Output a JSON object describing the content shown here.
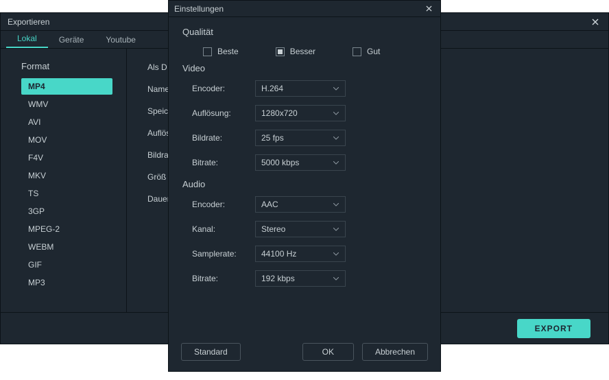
{
  "export": {
    "title": "Exportieren",
    "tabs": [
      "Lokal",
      "Geräte",
      "Youtube"
    ],
    "active_tab": 0,
    "sidebar_heading": "Format",
    "formats": [
      "MP4",
      "WMV",
      "AVI",
      "MOV",
      "F4V",
      "MKV",
      "TS",
      "3GP",
      "MPEG-2",
      "WEBM",
      "GIF",
      "MP3"
    ],
    "selected_format": 0,
    "main_labels": [
      "Als D",
      "Name",
      "Speich",
      "Auflös",
      "Bildra",
      "Größ",
      "Dauer"
    ],
    "export_button": "EXPORT"
  },
  "settings": {
    "title": "Einstellungen",
    "quality": {
      "label": "Qualität",
      "options": [
        "Beste",
        "Besser",
        "Gut"
      ],
      "selected": 1
    },
    "video": {
      "label": "Video",
      "fields": [
        {
          "label": "Encoder:",
          "value": "H.264"
        },
        {
          "label": "Auflösung:",
          "value": "1280x720"
        },
        {
          "label": "Bildrate:",
          "value": "25 fps"
        },
        {
          "label": "Bitrate:",
          "value": "5000 kbps"
        }
      ]
    },
    "audio": {
      "label": "Audio",
      "fields": [
        {
          "label": "Encoder:",
          "value": "AAC"
        },
        {
          "label": "Kanal:",
          "value": "Stereo"
        },
        {
          "label": "Samplerate:",
          "value": "44100 Hz"
        },
        {
          "label": "Bitrate:",
          "value": "192 kbps"
        }
      ]
    },
    "buttons": {
      "default": "Standard",
      "ok": "OK",
      "cancel": "Abbrechen"
    }
  }
}
